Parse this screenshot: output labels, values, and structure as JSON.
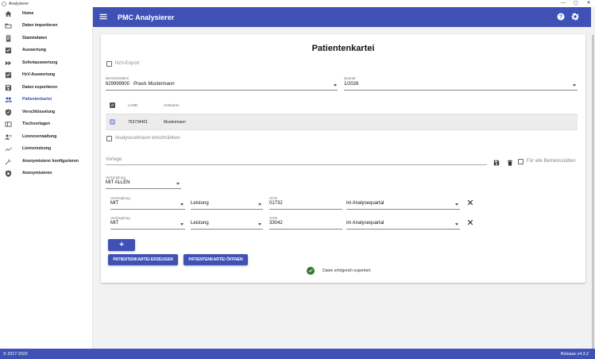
{
  "window": {
    "title": "Analysierer",
    "controls": [
      "—",
      "▢",
      "✕"
    ]
  },
  "sidebar": {
    "items": [
      {
        "label": "Home",
        "icon": "home-icon",
        "active": false
      },
      {
        "label": "Daten importieren",
        "icon": "folder-icon",
        "active": false
      },
      {
        "label": "Stammdaten",
        "icon": "document-icon",
        "active": false
      },
      {
        "label": "Auswertung",
        "icon": "check-square-icon",
        "active": false
      },
      {
        "label": "Sofortauswertung",
        "icon": "fast-forward-icon",
        "active": false
      },
      {
        "label": "HzV-Auswertung",
        "icon": "check-square-icon",
        "active": false
      },
      {
        "label": "Daten exportieren",
        "icon": "save-icon",
        "active": false
      },
      {
        "label": "Patientenkartei",
        "icon": "people-icon",
        "active": true
      },
      {
        "label": "Verschlüsselung",
        "icon": "shield-icon",
        "active": false
      },
      {
        "label": "Tischvorlagen",
        "icon": "panel-icon",
        "active": false
      },
      {
        "label": "Lizenzverwaltung",
        "icon": "person-gear-icon",
        "active": false
      },
      {
        "label": "Lizenznutzung",
        "icon": "trend-icon",
        "active": false
      },
      {
        "label": "Anonymisierer konfigurieren",
        "icon": "wrench-icon",
        "active": false
      },
      {
        "label": "Anonymisieren",
        "icon": "shield-gear-icon",
        "active": false
      }
    ]
  },
  "appbar": {
    "title": "PMC Analysierer",
    "menu_icon": "menu-icon",
    "help_icon": "help-icon",
    "settings_icon": "gear-icon"
  },
  "card": {
    "title": "Patientenkartei",
    "hzv_export": {
      "label": "HzV-Export",
      "checked": false
    },
    "betriebsstaetten": {
      "label": "Betriebsstätten",
      "value_id": "629999900",
      "value_name": "Praxis Mustermann"
    },
    "quartal": {
      "label": "Quartal",
      "value": "1/2026"
    },
    "table": {
      "headers": [
        "LANR",
        "Arztname"
      ],
      "rows": [
        {
          "lanr": "753734401",
          "arztname": "Mustermann",
          "checked": true
        }
      ]
    },
    "analysezeitraum": {
      "label": "Analysezeitraum einschränken",
      "checked": false
    },
    "vorlage": {
      "placeholder": "Vorlage",
      "alle_betriebsstaetten_label": "Für alle Betriebsstätten"
    },
    "verknuepfung_main": {
      "label": "Verknüpfung",
      "value": "MIT ALLEN"
    },
    "conditions": [
      {
        "verknuepfung_label": "Verknüpfung",
        "verknuepfung": "MIT",
        "typ": "Leistung",
        "gon_label": "GON",
        "gon": "01732",
        "zeitraum": "im Analysequartal"
      },
      {
        "verknuepfung_label": "Verknüpfung",
        "verknuepfung": "MIT",
        "typ": "Leistung",
        "gon_label": "GON",
        "gon": "33042",
        "zeitraum": "im Analysequartal"
      }
    ],
    "add_button": "+",
    "create_button": "PATIENTENKARTEI ERZEUGEN",
    "open_button": "PATIENTENKARTEI ÖFFNEN",
    "status": "Daten erfolgreich exportiert."
  },
  "footer": {
    "copyright": "© 2017-2023",
    "release": "Release v4.3.2"
  },
  "colors": {
    "primary": "#3f51b5",
    "success": "#2e7d32"
  }
}
